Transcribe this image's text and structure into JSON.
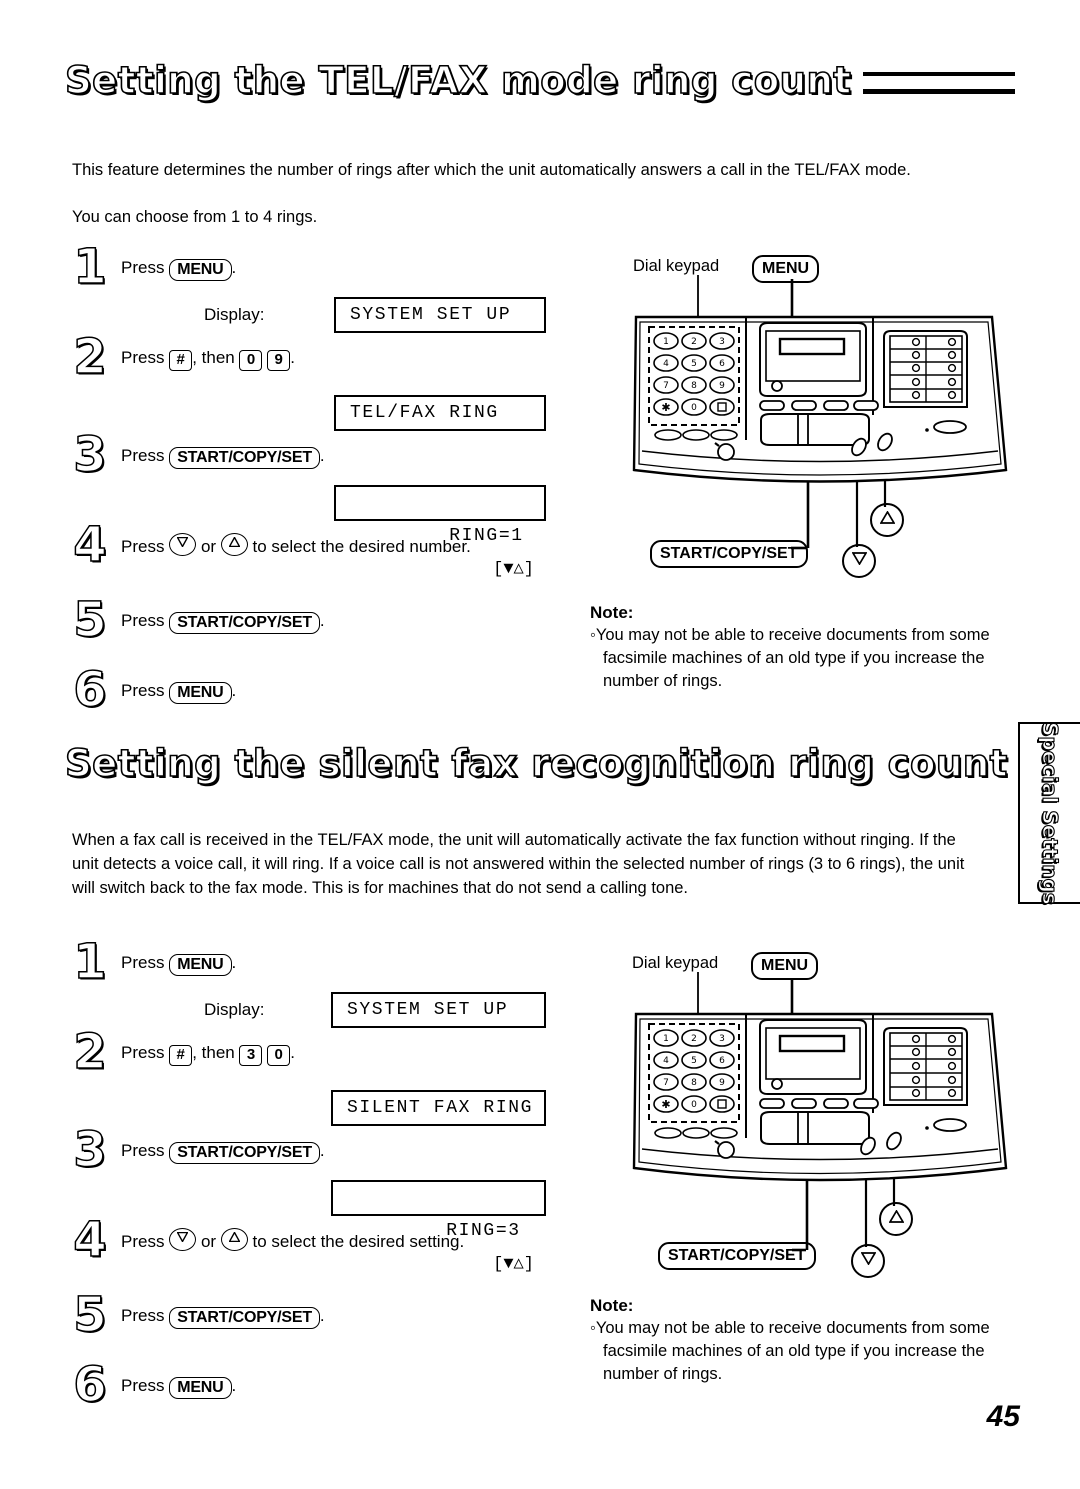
{
  "page": {
    "number": "45",
    "side_tab": "Special Settings"
  },
  "sections": [
    {
      "heading": "Setting the TEL/FAX mode ring count",
      "intro": [
        "This feature determines the number of rings after which the unit automatically answers a call in the TEL/FAX mode.",
        "You can choose from 1 to 4 rings."
      ],
      "steps": [
        {
          "num": "1",
          "press_word": "Press",
          "button": "MENU",
          "tail": "."
        },
        {
          "num": "2",
          "press_word": "Press",
          "key1": "#",
          "mid": ", then",
          "key2": "0",
          "key3": "9",
          "tail": "."
        },
        {
          "num": "3",
          "press_word": "Press",
          "button": "START/COPY/SET",
          "tail": "."
        },
        {
          "num": "4",
          "press_word": "Press",
          "arrow_down": "down-arrow",
          "or_word": "or",
          "arrow_up": "up-arrow",
          "tail_text": "to select the desired number."
        },
        {
          "num": "5",
          "press_word": "Press",
          "button": "START/COPY/SET",
          "tail": "."
        },
        {
          "num": "6",
          "press_word": "Press",
          "button": "MENU",
          "tail": "."
        }
      ],
      "display_label": "Display:",
      "displays": [
        {
          "text": "SYSTEM SET UP",
          "right": ""
        },
        {
          "text": "TEL/FAX RING",
          "right": ""
        },
        {
          "text": "RING=1",
          "right": "[▼△]"
        }
      ],
      "diagram": {
        "dial_keypad_label": "Dial keypad",
        "menu_callout": "MENU",
        "start_callout": "START/COPY/SET",
        "keypad_keys": [
          "1",
          "2",
          "3",
          "4",
          "5",
          "6",
          "7",
          "8",
          "9",
          "✱",
          "0",
          "□"
        ]
      },
      "note": {
        "title": "Note:",
        "body": "◦You may not be able to receive documents from some facsimile machines of an old type if you increase the number of rings."
      }
    },
    {
      "heading": "Setting the silent fax recognition ring count",
      "intro": [
        "When a fax call is received in the TEL/FAX mode, the unit will automatically activate the fax function without ringing. If the unit detects a voice call, it will ring. If a voice call is not answered within the selected number of rings (3 to 6 rings), the unit will switch back to the fax mode. This is for machines that do not send a calling tone."
      ],
      "steps": [
        {
          "num": "1",
          "press_word": "Press",
          "button": "MENU",
          "tail": "."
        },
        {
          "num": "2",
          "press_word": "Press",
          "key1": "#",
          "mid": ", then",
          "key2": "3",
          "key3": "0",
          "tail": "."
        },
        {
          "num": "3",
          "press_word": "Press",
          "button": "START/COPY/SET",
          "tail": "."
        },
        {
          "num": "4",
          "press_word": "Press",
          "arrow_down": "down-arrow",
          "or_word": "or",
          "arrow_up": "up-arrow",
          "tail_text": "to select the desired setting."
        },
        {
          "num": "5",
          "press_word": "Press",
          "button": "START/COPY/SET",
          "tail": "."
        },
        {
          "num": "6",
          "press_word": "Press",
          "button": "MENU",
          "tail": "."
        }
      ],
      "display_label": "Display:",
      "displays": [
        {
          "text": "SYSTEM SET UP",
          "right": ""
        },
        {
          "text": "SILENT FAX RING",
          "right": ""
        },
        {
          "text": "RING=3",
          "right": "[▼△]"
        }
      ],
      "diagram": {
        "dial_keypad_label": "Dial keypad",
        "menu_callout": "MENU",
        "start_callout": "START/COPY/SET",
        "keypad_keys": [
          "1",
          "2",
          "3",
          "4",
          "5",
          "6",
          "7",
          "8",
          "9",
          "✱",
          "0",
          "□"
        ]
      },
      "note": {
        "title": "Note:",
        "body": "◦You may not be able to receive documents from some facsimile machines of an old type if you increase the number of rings."
      }
    }
  ]
}
